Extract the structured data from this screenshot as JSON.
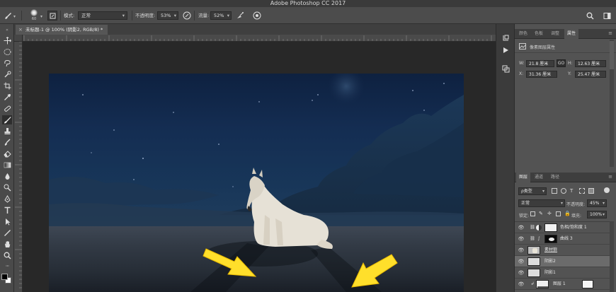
{
  "app": {
    "title": "Adobe Photoshop CC 2017"
  },
  "options_bar": {
    "brush_size": "60",
    "mode_label": "模式:",
    "mode_value": "正常",
    "opacity_label": "不透明度:",
    "opacity_value": "53%",
    "flow_label": "流量:",
    "flow_value": "52%"
  },
  "document": {
    "tab_title": "未标题-1 @ 100% (阴影2, RGB/8) *",
    "close_glyph": "×"
  },
  "properties_panel": {
    "tabs": [
      "颜色",
      "色板",
      "调整",
      "属性"
    ],
    "header": "像素图层属性",
    "w_label": "W:",
    "w_value": "21.8 厘米",
    "link_glyph": "GO",
    "h_label": "H:",
    "h_value": "12.63 厘米",
    "x_label": "X:",
    "x_value": "31.36 厘米",
    "y_label": "Y:",
    "y_value": "25.47 厘米"
  },
  "layers_panel": {
    "tabs": [
      "图层",
      "通道",
      "路径"
    ],
    "filter_label": "ρ类型",
    "blend_mode": "正常",
    "opacity_label": "不透明度:",
    "opacity_value": "45%",
    "lock_label": "锁定:",
    "fill_label": "填充:",
    "fill_value": "100%",
    "layers": [
      {
        "name": "色相/饱和度 1",
        "kind": "adjustment",
        "selected": false,
        "thumb": "#f2f2f2"
      },
      {
        "name": "曲线 3",
        "kind": "adjustment",
        "selected": false,
        "thumb": "#000000"
      },
      {
        "name": "素材狼",
        "kind": "pixel",
        "selected": false,
        "thumb": "#c9c9c9"
      },
      {
        "name": "阴影2",
        "kind": "pixel",
        "selected": true,
        "thumb": "#dcdcdc"
      },
      {
        "name": "阴影1",
        "kind": "pixel",
        "selected": false,
        "thumb": "#dcdcdc"
      },
      {
        "name": "图层 1",
        "kind": "pixel",
        "selected": false,
        "thumb": "#eeeeee"
      }
    ]
  },
  "colors": {
    "foreground": "#000000",
    "background": "#ffffff",
    "arrow": "#ffdf2b"
  }
}
